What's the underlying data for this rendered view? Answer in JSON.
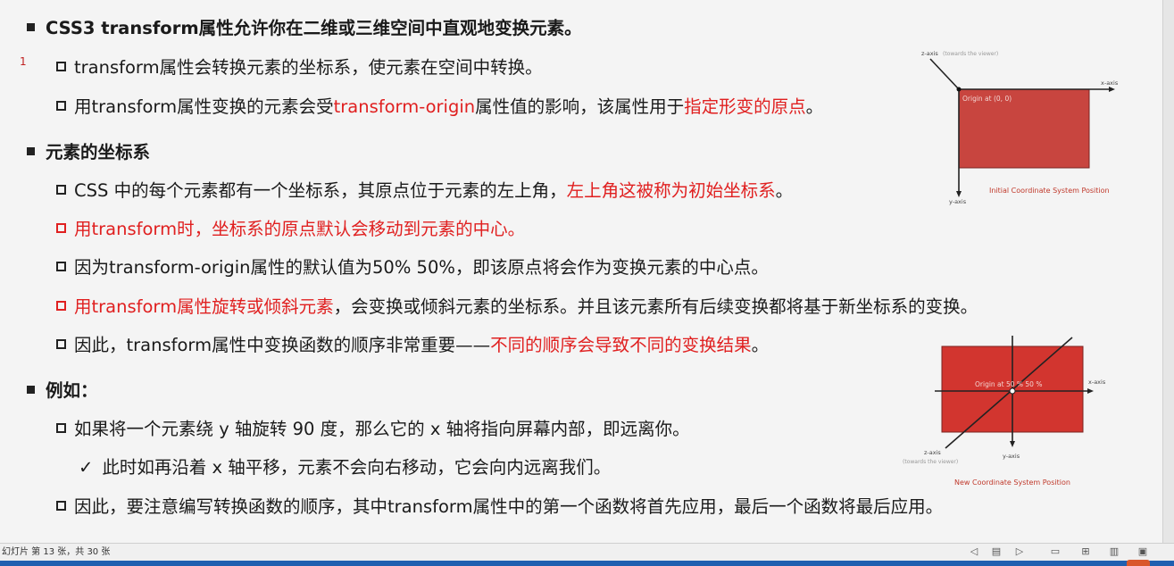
{
  "slide": {
    "marker": "1",
    "items": [
      {
        "level": 1,
        "parts": [
          {
            "t": "CSS3 transform属性允许你在二维或三维空间中直观地变换元素。"
          }
        ]
      },
      {
        "level": 2,
        "parts": [
          {
            "t": "transform属性会转换元素的坐标系，使元素在空间中转换。"
          }
        ]
      },
      {
        "level": 2,
        "parts": [
          {
            "t": "用transform属性变换的元素会受"
          },
          {
            "t": "transform-origin",
            "red": true
          },
          {
            "t": "属性值的影响，该属性用于"
          },
          {
            "t": "指定形变的原点",
            "red": true
          },
          {
            "t": "。"
          }
        ]
      },
      {
        "level": 1,
        "parts": [
          {
            "t": "元素的坐标系"
          }
        ]
      },
      {
        "level": 2,
        "parts": [
          {
            "t": "CSS 中的每个元素都有一个坐标系，其原点位于元素的左上角，"
          },
          {
            "t": "左上角这被称为初始坐标系",
            "red": true
          },
          {
            "t": "。"
          }
        ]
      },
      {
        "level": 2,
        "redbox": true,
        "parts": [
          {
            "t": "用transform时，坐标系的原点默认会移动到元素的中心。",
            "red": true
          }
        ]
      },
      {
        "level": 2,
        "parts": [
          {
            "t": "因为transform-origin属性的默认值为50% 50%，即该原点将会作为变换元素的中心点。"
          }
        ]
      },
      {
        "level": 2,
        "redbox": true,
        "parts": [
          {
            "t": "用transform属性旋转或倾斜元素",
            "red": true
          },
          {
            "t": "，会变换或倾斜元素的坐标系。并且该元素所有后续变换都将基于新坐标系的变换。"
          }
        ]
      },
      {
        "level": 2,
        "parts": [
          {
            "t": "因此，transform属性中变换函数的顺序非常重要——"
          },
          {
            "t": "不同的顺序会导致不同的变换结果",
            "red": true
          },
          {
            "t": "。"
          }
        ]
      },
      {
        "level": 1,
        "parts": [
          {
            "t": "例如："
          }
        ]
      },
      {
        "level": 2,
        "parts": [
          {
            "t": "如果将一个元素绕 y 轴旋转 90 度，那么它的 x 轴将指向屏幕内部，即远离你。"
          }
        ]
      },
      {
        "level": 3,
        "parts": [
          {
            "t": "此时如再沿着 x 轴平移，元素不会向右移动，它会向内远离我们。"
          }
        ]
      },
      {
        "level": 2,
        "parts": [
          {
            "t": "因此，要注意编写转换函数的顺序，其中transform属性中的第一个函数将首先应用，最后一个函数将最后应用。"
          }
        ]
      }
    ]
  },
  "figure1": {
    "z_axis": "z-axis",
    "z_note": "(towards the viewer)",
    "x_axis": "x-axis",
    "y_axis": "y-axis",
    "origin": "Origin at (0, 0)",
    "caption": "Initial Coordinate System Position"
  },
  "figure2": {
    "x_axis": "x-axis",
    "y_axis": "y-axis",
    "z_axis": "z-axis",
    "z_note": "(towards the viewer)",
    "origin": "Origin at 50 % 50 %",
    "caption": "New Coordinate System Position"
  },
  "status": {
    "slide_info": "幻灯片 第 13 张，共 30 张"
  },
  "icons": {
    "square_bullet": "square-bullet-icon",
    "hollow_box": "hollow-square-bullet-icon",
    "check": "check-icon",
    "prev": "previous-slide-icon",
    "notes": "notes-icon",
    "next": "next-slide-icon",
    "normal_view": "normal-view-icon",
    "sorter_view": "slide-sorter-icon",
    "reading_view": "reading-view-icon",
    "slideshow_view": "slideshow-icon"
  },
  "colors": {
    "accent_red": "#e02020",
    "shape_red": "#c8453f",
    "shape_red_2": "#d2352f",
    "caption_red": "#c0392b"
  }
}
